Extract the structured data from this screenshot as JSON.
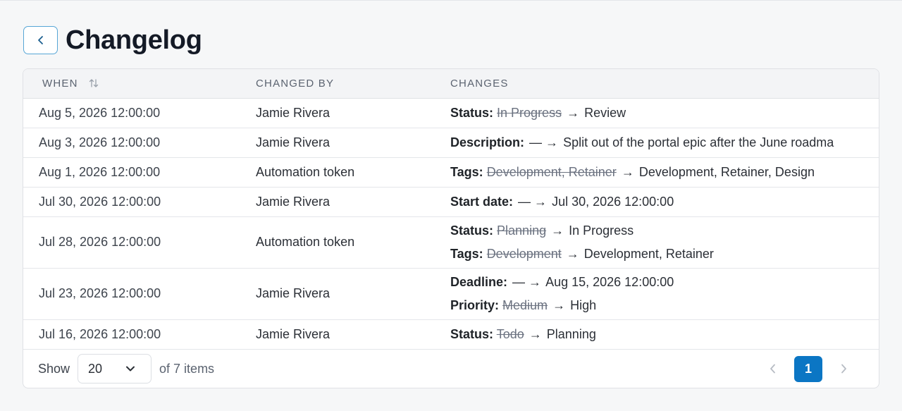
{
  "header": {
    "title": "Changelog"
  },
  "table": {
    "columns": [
      "WHEN",
      "CHANGED BY",
      "CHANGES"
    ],
    "rows": [
      {
        "when": "Aug 5, 2026 12:00:00",
        "by": "Jamie Rivera",
        "changes": [
          {
            "field": "Status:",
            "old": "In Progress",
            "arrow": "→",
            "new": "Review"
          }
        ]
      },
      {
        "when": "Aug 3, 2026 12:00:00",
        "by": "Jamie Rivera",
        "changes": [
          {
            "field": "Description:",
            "old": "",
            "arrow": "— →",
            "new": "Split out of the portal epic after the June roadma"
          }
        ]
      },
      {
        "when": "Aug 1, 2026 12:00:00",
        "by": "Automation token",
        "changes": [
          {
            "field": "Tags:",
            "old": "Development, Retainer",
            "arrow": "→",
            "new": "Development, Retainer, Design"
          }
        ]
      },
      {
        "when": "Jul 30, 2026 12:00:00",
        "by": "Jamie Rivera",
        "changes": [
          {
            "field": "Start date:",
            "old": "",
            "arrow": "— →",
            "new": "Jul 30, 2026 12:00:00"
          }
        ]
      },
      {
        "when": "Jul 28, 2026 12:00:00",
        "by": "Automation token",
        "changes": [
          {
            "field": "Status:",
            "old": "Planning",
            "arrow": "→",
            "new": "In Progress"
          },
          {
            "field": "Tags:",
            "old": "Development",
            "arrow": "→",
            "new": "Development, Retainer"
          }
        ]
      },
      {
        "when": "Jul 23, 2026 12:00:00",
        "by": "Jamie Rivera",
        "changes": [
          {
            "field": "Deadline:",
            "old": "",
            "arrow": "— →",
            "new": "Aug 15, 2026 12:00:00"
          },
          {
            "field": "Priority:",
            "old": "Medium",
            "arrow": "→",
            "new": "High"
          }
        ]
      },
      {
        "when": "Jul 16, 2026 12:00:00",
        "by": "Jamie Rivera",
        "changes": [
          {
            "field": "Status:",
            "old": "Todo",
            "arrow": "→",
            "new": "Planning"
          }
        ]
      }
    ]
  },
  "footer": {
    "show_label": "Show",
    "page_size": "20",
    "of_items": "of 7 items",
    "current_page": "1"
  },
  "icons": {
    "back": "chevron-left-icon",
    "sort": "sort-icon",
    "select": "chevron-down-icon",
    "prev": "chevron-left-icon",
    "next": "chevron-right-icon"
  },
  "colors": {
    "accent": "#0b76c4",
    "back_border": "#57a6d6"
  }
}
